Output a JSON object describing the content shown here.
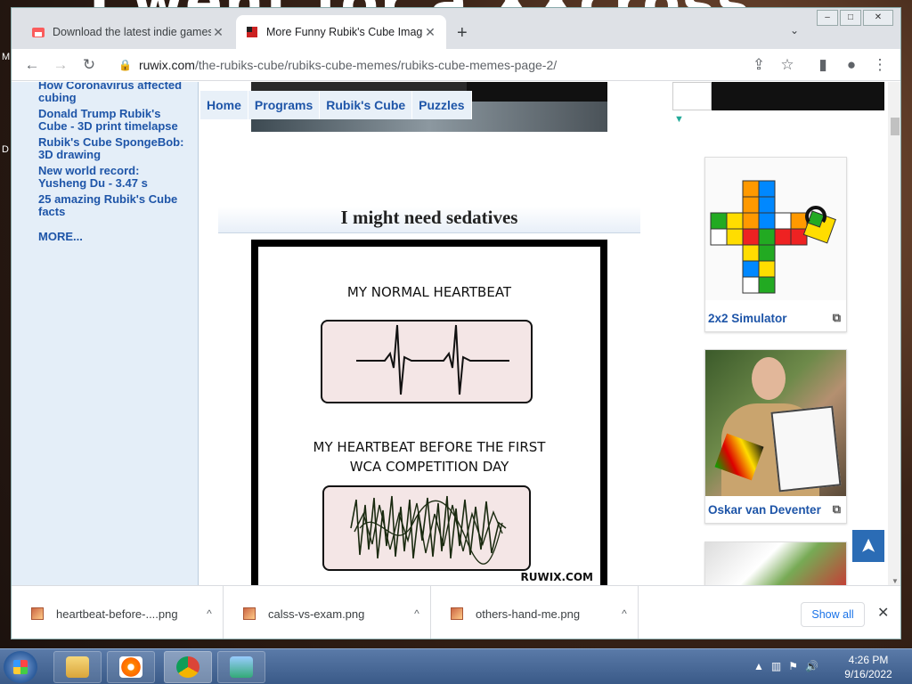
{
  "desktop": {
    "banner_text": "I went for a XXcross.",
    "side_letters": [
      "M",
      "D"
    ]
  },
  "window": {
    "controls": [
      "–",
      "□",
      "✕"
    ]
  },
  "tabs": [
    {
      "title": "Download the latest indie games",
      "close": "✕"
    },
    {
      "title": "More Funny Rubik's Cube Images",
      "close": "✕"
    }
  ],
  "tabstrip": {
    "new_tab": "+",
    "tab_menu": "⌄"
  },
  "toolbar": {
    "back": "←",
    "forward": "→",
    "reload": "↻",
    "url_host": "ruwix.com",
    "url_path": "/the-rubiks-cube/rubiks-cube-memes/rubiks-cube-memes-page-2/",
    "share": "⇪",
    "bookmark": "☆",
    "sidebar": "▮",
    "profile": "●",
    "menu": "⋮"
  },
  "sidebar": {
    "links": [
      "How Coronavirus affected cubing",
      "Donald Trump Rubik's Cube - 3D print timelapse",
      "Rubik's Cube SpongeBob: 3D drawing",
      "New world record: Yusheng Du - 3.47 s",
      "25 amazing Rubik's Cube facts"
    ],
    "more": "MORE..."
  },
  "nav": [
    "Home",
    "Programs",
    "Rubik's Cube",
    "Puzzles"
  ],
  "article": {
    "heading": "I might need sedatives",
    "meme": {
      "caption1": "MY NORMAL HEARTBEAT",
      "caption2_line1": "MY HEARTBEAT BEFORE THE FIRST",
      "caption2_line2": "WCA COMPETITION DAY",
      "watermark": "RUWIX.COM"
    }
  },
  "right_cards": [
    {
      "label": "2x2 Simulator",
      "ext": "⧉"
    },
    {
      "label": "Oskar van Deventer",
      "ext": "⧉"
    }
  ],
  "scroll_top": "➤",
  "downloads": {
    "items": [
      {
        "name": "heartbeat-before-....png",
        "chevron": "^"
      },
      {
        "name": "calss-vs-exam.png",
        "chevron": "^"
      },
      {
        "name": "others-hand-me.png",
        "chevron": "^"
      }
    ],
    "show_all": "Show all",
    "close": "✕"
  },
  "taskbar": {
    "time": "4:26 PM",
    "date": "9/16/2022"
  },
  "colors": {
    "link_blue": "#1e55a8",
    "sidebar_bg": "#e4eef8",
    "scroll_top_bg": "#2b6cb5"
  }
}
